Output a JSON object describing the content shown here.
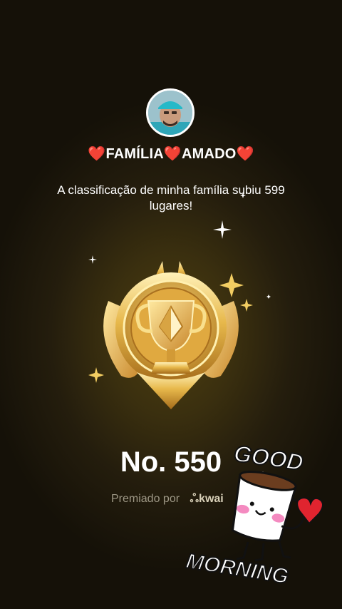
{
  "profile": {
    "family_name": "❤️FAMÍLIA❤️AMADO❤️"
  },
  "message": "A classificação de minha família subiu 599 lugares!",
  "rank": "No. 550",
  "awarded": {
    "prefix": "Premiado por",
    "brand": "kwai"
  },
  "sticker": {
    "line1": "GOOD",
    "line2": "MORNING"
  },
  "colors": {
    "gold": "#e6b84a",
    "background": "#2b230e"
  }
}
